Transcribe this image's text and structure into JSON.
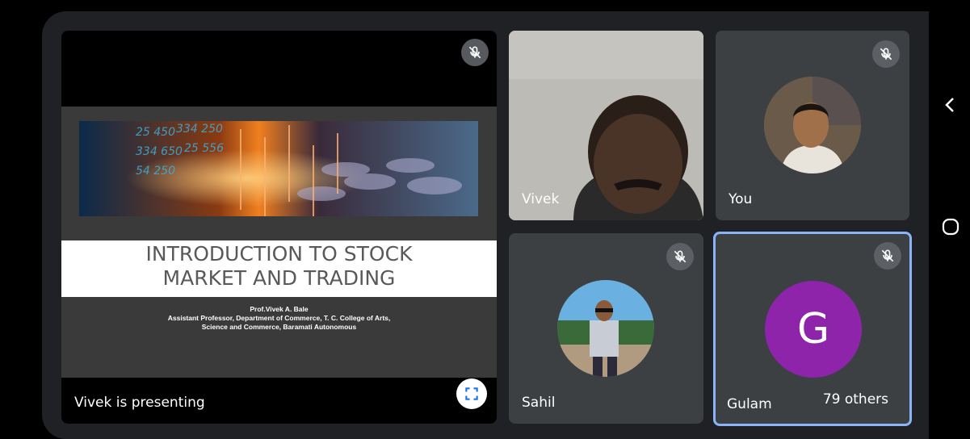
{
  "presentation": {
    "presenting_label": "Vivek is presenting",
    "slide": {
      "title_line1": "INTRODUCTION TO STOCK",
      "title_line2": "MARKET AND TRADING",
      "author": "Prof.Vivek A. Bale",
      "affiliation_line1": "Assistant Professor, Department of Commerce, T. C. College of Arts,",
      "affiliation_line2": "Science and Commerce, Baramati Autonomous",
      "banner_numbers": [
        "334 650",
        "25 556",
        "54 250",
        "334 250",
        "25 450"
      ]
    }
  },
  "participants": [
    {
      "name": "Vivek",
      "muted": false
    },
    {
      "name": "You",
      "muted": true
    },
    {
      "name": "Sahil",
      "muted": true
    },
    {
      "name": "Gulam",
      "muted": true,
      "initial": "G",
      "avatar_color": "#8e24aa",
      "active_speaker": true
    }
  ],
  "others_count_label": "79 others",
  "colors": {
    "background": "#202124",
    "tile": "#3c4043",
    "active_border": "#8ab4f8",
    "fullscreen_icon": "#1a73e8"
  },
  "icons": {
    "mic_off": "mic-off-icon",
    "fullscreen": "fullscreen-icon",
    "back": "chevron-left-icon",
    "home": "home-icon"
  }
}
